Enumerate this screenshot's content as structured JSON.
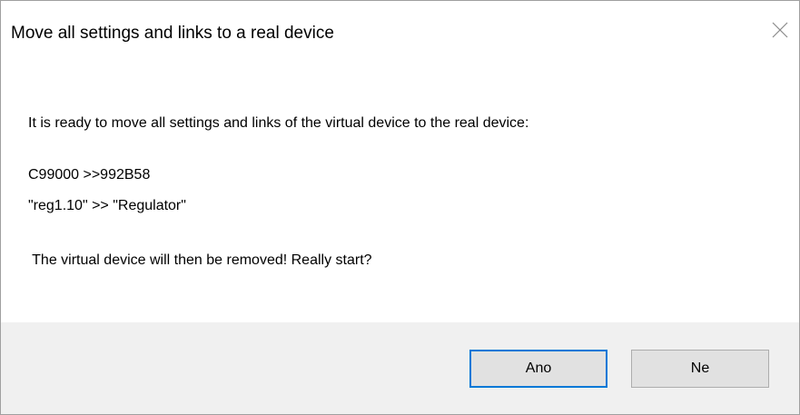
{
  "dialog": {
    "title": "Move all settings and links to a real device",
    "close_icon": "close-icon",
    "message": {
      "intro": "It is ready to move all settings and links of the virtual device to the real device:",
      "address_mapping": "C99000 >>992B58",
      "name_mapping": "\"reg1.10\" >> \"Regulator\"",
      "warning": " The virtual device will then be removed! Really start?"
    },
    "buttons": {
      "yes_label": "Ano",
      "no_label": "Ne"
    },
    "colors": {
      "footer_background": "#f0f0f0",
      "default_button_border": "#0078d7",
      "button_background": "#e1e1e1"
    }
  }
}
